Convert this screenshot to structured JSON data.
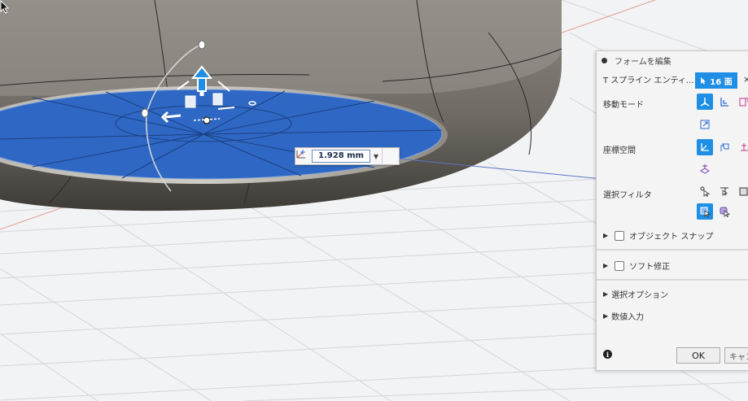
{
  "colors": {
    "accent": "#1f8fe5",
    "face_selected": "#2f68c4",
    "body": "#77736b",
    "background": "#f2f3f4"
  },
  "viewport": {
    "dimension_value": "1.928 mm",
    "dimension_caret": "▼",
    "dimension_menu_icon": "dimension-options-icon"
  },
  "panel": {
    "title": "フォームを編集",
    "selection_label": "T スプライン エンティ...",
    "selection_count": "16 面",
    "close_label": "×",
    "move_mode_label": "移動モード",
    "coordinate_space_label": "座標空間",
    "selection_filter_label": "選択フィルタ",
    "object_snap_label": "オブジェクト スナップ",
    "soft_modify_label": "ソフト修正",
    "selection_options_label": "選択オプション",
    "numeric_input_label": "数値入力",
    "ok_label": "OK",
    "cancel_label": "キャンセル",
    "info_icon": "i"
  }
}
